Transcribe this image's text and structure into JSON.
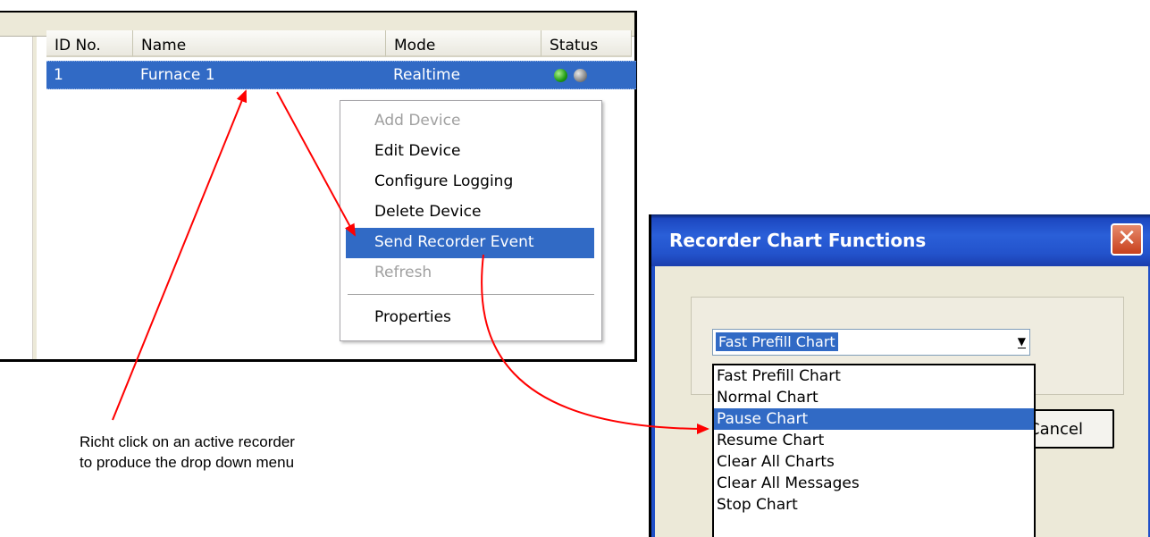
{
  "device_table": {
    "columns": [
      "ID No.",
      "Name",
      "Mode",
      "Status"
    ],
    "rows": [
      {
        "id": "1",
        "name": "Furnace 1",
        "mode": "Realtime",
        "status_leds": [
          "green",
          "gray"
        ]
      }
    ]
  },
  "context_menu": {
    "items": [
      {
        "label": "Add Device",
        "state": "disabled"
      },
      {
        "label": "Edit Device",
        "state": "enabled"
      },
      {
        "label": "Configure Logging",
        "state": "enabled"
      },
      {
        "label": "Delete Device",
        "state": "enabled"
      },
      {
        "label": "Send Recorder Event",
        "state": "highlighted"
      },
      {
        "label": "Refresh",
        "state": "disabled"
      },
      {
        "label": "Properties",
        "state": "enabled"
      }
    ]
  },
  "caption": {
    "line1": "Richt click on an active recorder",
    "line2": "to produce the drop down menu"
  },
  "dialog": {
    "title": "Recorder Chart Functions",
    "close_glyph": "✕",
    "combo_value": "Fast Prefill Chart",
    "cancel_label": "Cancel",
    "options": [
      "Fast Prefill Chart",
      "Normal Chart",
      "Pause Chart",
      "Resume Chart",
      "Clear All Charts",
      "Clear All Messages",
      "Stop Chart"
    ],
    "highlighted_option": "Pause Chart"
  },
  "colors": {
    "selection": "#316ac5",
    "titlebar": "#2a5fd8",
    "annotation_arrow": "#ff0000"
  }
}
